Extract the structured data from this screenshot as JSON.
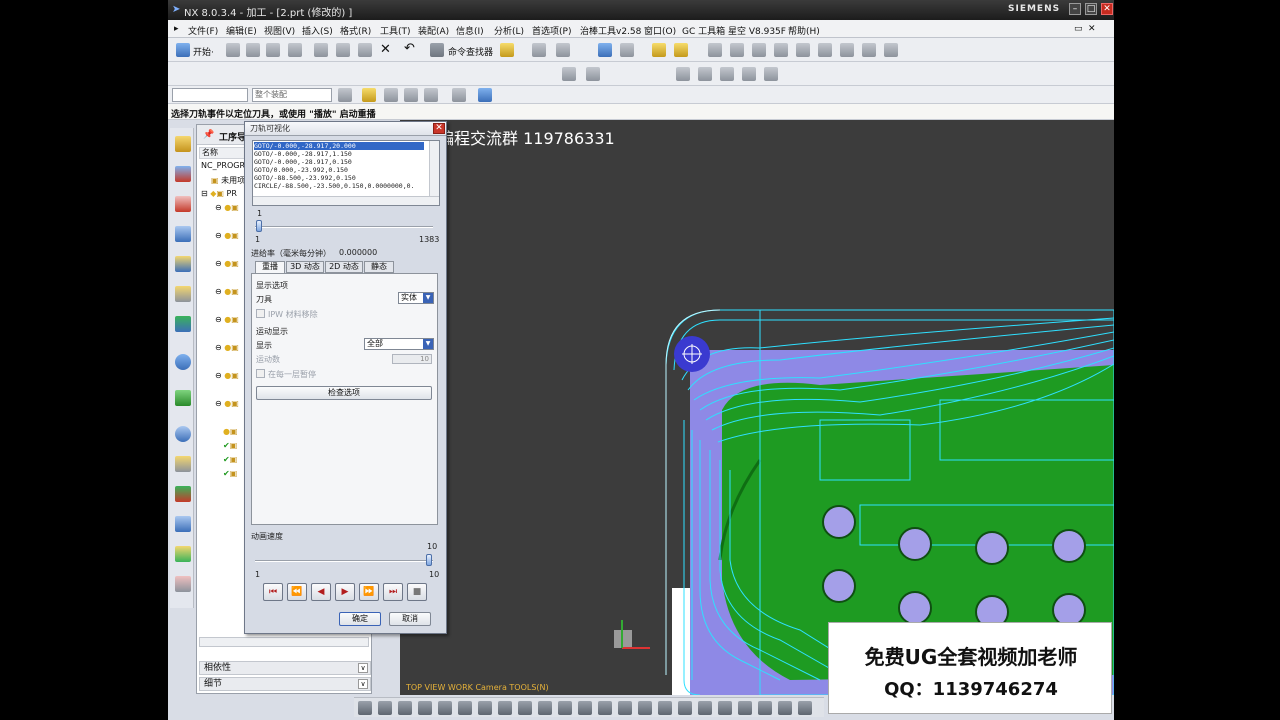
{
  "window": {
    "title": "NX 8.0.3.4 - 加工 - [2.prt  (修改的) ]",
    "brand": "SIEMENS"
  },
  "menu": [
    "文件(F)",
    "编辑(E)",
    "视图(V)",
    "插入(S)",
    "格式(R)",
    "工具(T)",
    "装配(A)",
    "信息(I)",
    "分析(L)",
    "首选项(P)",
    "治棒工具v2.58",
    "窗口(O)",
    "GC 工具箱",
    "星空 V8.935F",
    "帮助(H)"
  ],
  "toolbar": {
    "start_label": "开始·",
    "command_finder_label": "命令查找器"
  },
  "selection_bar": {
    "filter_combo": "",
    "scope_combo": "整个装配"
  },
  "cue_line": "选择刀轨事件以定位刀具，或使用 \"播放\" 启动重播",
  "navigator": {
    "title": "工序导",
    "column_name": "名称",
    "root": "NC_PROGRAM",
    "unused": "未用项",
    "program": "PR",
    "dependencies_label": "相依性",
    "details_label": "细节"
  },
  "viewport": {
    "watermark": "编程交流群 119786331",
    "view_label": "TOP VIEW WORK Camera TOOLS(N)"
  },
  "promo": {
    "line1": "免费UG全套视频加老师",
    "line2": "QQ：1139746274"
  },
  "dialog": {
    "title": "刀轨可视化",
    "close": "✕",
    "commands": [
      "GOTO/-0.000,-28.917,20.000",
      "GOTO/-0.000,-28.917,1.150",
      "GOTO/-0.000,-28.917,0.150",
      "GOTO/0.000,-23.992,0.150",
      "GOTO/-88.500,-23.992,0.150",
      "CIRCLE/-88.500,-23.500,0.150,0.0000000,0."
    ],
    "selected_index": 0,
    "position_value": "1",
    "range_min": "1",
    "range_max": "1383",
    "feed_rate_label": "进给率（毫米每分钟）",
    "feed_rate_value": "0.000000",
    "tabs": [
      "重播",
      "3D 动态",
      "2D 动态",
      "静态"
    ],
    "active_tab": 0,
    "display_options_label": "显示选项",
    "tool_label": "刀具",
    "tool_value": "实体",
    "ipw_label": "IPW 材料移除",
    "motion_display_label": "运动显示",
    "display_label": "显示",
    "display_value": "全部",
    "motion_count_label": "运动数",
    "motion_count_value": "10",
    "each_layer_label": "在每一层暂停",
    "check_options_label": "检查选项",
    "animation_speed_label": "动画速度",
    "speed_value": 10,
    "speed_min": "1",
    "speed_max": "10",
    "speed_top_label": "10",
    "ok_label": "确定",
    "cancel_label": "取消",
    "playback_buttons": [
      "to-start",
      "step-back",
      "play-reverse",
      "play",
      "step-forward",
      "to-end",
      "stop"
    ]
  },
  "colors": {
    "viewport_bg": "#3c3c3c",
    "part_green": "#1e9b22",
    "toolpath_cyan": "#2fe0ff",
    "stock_purple": "#8e89e6",
    "hole_purple": "#a49fe8"
  }
}
